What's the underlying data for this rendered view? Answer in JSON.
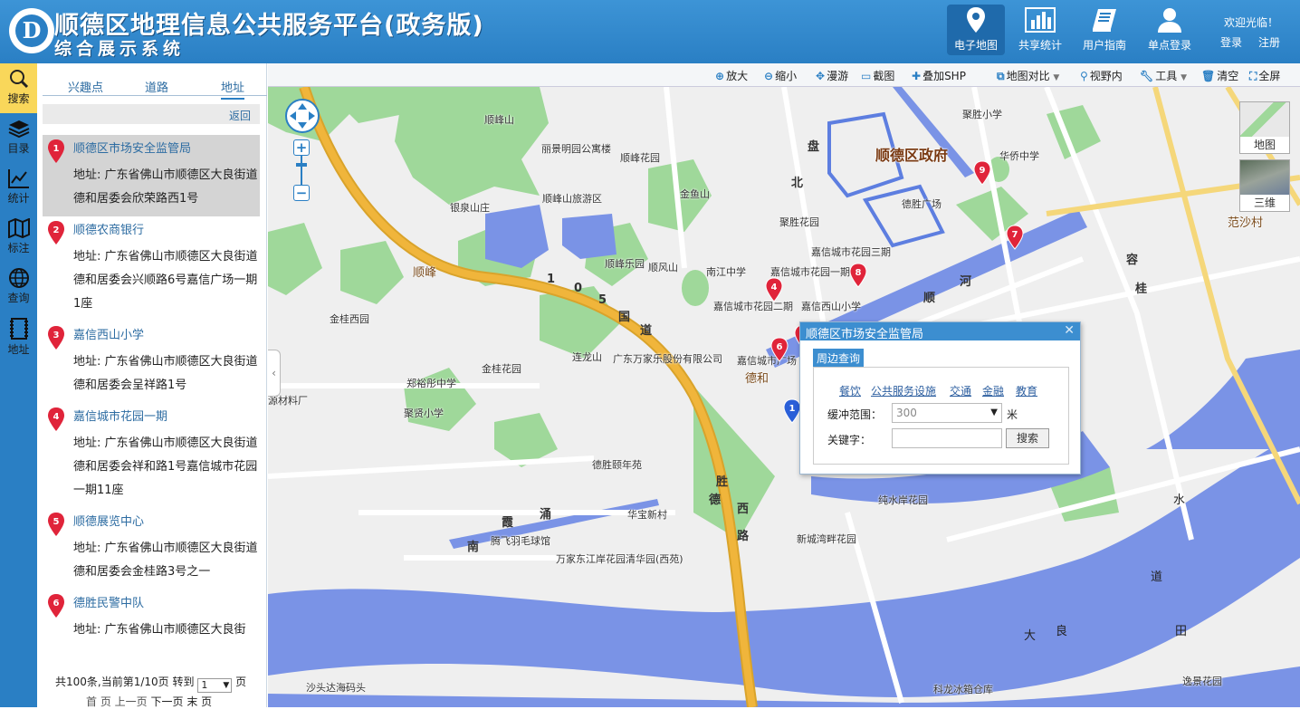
{
  "header": {
    "title": "顺德区地理信息公共服务平台(政务版)",
    "subtitle": "综合展示系统",
    "logo_letter": "D",
    "nav": [
      {
        "label": "电子地图",
        "icon": "map-pin-icon"
      },
      {
        "label": "共享统计",
        "icon": "bar-chart-icon"
      },
      {
        "label": "用户指南",
        "icon": "book-icon"
      },
      {
        "label": "单点登录",
        "icon": "user-icon"
      }
    ],
    "welcome": "欢迎光临！",
    "login": "登录",
    "register": "注册"
  },
  "iconbar": [
    {
      "label": "搜索",
      "icon": "search-icon",
      "active": true
    },
    {
      "label": "目录",
      "icon": "layers-icon"
    },
    {
      "label": "统计",
      "icon": "line-chart-icon"
    },
    {
      "label": "标注",
      "icon": "map-mark-icon"
    },
    {
      "label": "查询",
      "icon": "globe-icon"
    },
    {
      "label": "地址",
      "icon": "film-icon"
    }
  ],
  "panel": {
    "tabs": [
      "兴趣点",
      "道路",
      "地址"
    ],
    "back": "返回",
    "results": [
      {
        "no": "1",
        "name": "顺德区市场安全监管局",
        "address": "地址: 广东省佛山市顺德区大良街道德和居委会欣荣路西1号"
      },
      {
        "no": "2",
        "name": "顺德农商银行",
        "address": "地址: 广东省佛山市顺德区大良街道德和居委会兴顺路6号嘉信广场一期1座"
      },
      {
        "no": "3",
        "name": "嘉信西山小学",
        "address": "地址: 广东省佛山市顺德区大良街道德和居委会呈祥路1号"
      },
      {
        "no": "4",
        "name": "嘉信城市花园一期",
        "address": "地址: 广东省佛山市顺德区大良街道德和居委会祥和路1号嘉信城市花园一期11座"
      },
      {
        "no": "5",
        "name": "顺德展览中心",
        "address": "地址: 广东省佛山市顺德区大良街道德和居委会金桂路3号之一"
      },
      {
        "no": "6",
        "name": "德胜民警中队",
        "address": "地址: 广东省佛山市顺德区大良街"
      }
    ],
    "pager": {
      "summary": "共100条,当前第1/10页 转到",
      "page_value": "1",
      "page_unit": "页",
      "links": [
        "首 页",
        "上一页",
        "下一页",
        "末 页"
      ]
    }
  },
  "toolbar": [
    {
      "label": "放大",
      "icon": "zoom-in-icon"
    },
    {
      "label": "缩小",
      "icon": "zoom-out-icon"
    },
    {
      "label": "漫游",
      "icon": "pan-icon"
    },
    {
      "label": "截图",
      "icon": "screenshot-icon"
    },
    {
      "label": "叠加SHP",
      "icon": "plus-icon"
    },
    {
      "label": "地图对比",
      "icon": "compare-icon"
    },
    {
      "label": "视野内",
      "icon": "search-icon"
    },
    {
      "label": "工具",
      "icon": "wrench-icon"
    },
    {
      "label": "清空",
      "icon": "trash-icon"
    },
    {
      "label": "全屏",
      "icon": "fullscreen-icon"
    }
  ],
  "map": {
    "basemaps": [
      "地图",
      "三维"
    ],
    "labels": [
      "顺峰山",
      "丽景明园公寓楼",
      "顺峰花园",
      "银泉山庄",
      "顺峰山旅游区",
      "金鱼山",
      "顺峰乐园",
      "顺风山",
      "顺峰",
      "金桂西园",
      "金桂花园",
      "连龙山",
      "郑裕彤中学",
      "聚贤小学",
      "德胜颐年苑",
      "华宝新村",
      "腾飞羽毛球馆",
      "万家东江岸花园清华园(西苑)",
      "广东万家乐股份有限公司",
      "德和",
      "聚胜小学",
      "华侨中学",
      "德胜广场",
      "聚胜花园",
      "嘉信城市花园三期",
      "嘉信城市花园一期",
      "南江中学",
      "嘉信城市花园二期",
      "嘉信西山小学",
      "嘉信城市广场",
      "纯水岸花园",
      "新城湾畔花园",
      "范沙村",
      "沙头达海码头",
      "科龙冰箱仓库",
      "逸景花园",
      "源材料厂",
      "顺德区政府"
    ],
    "roads": [
      "1",
      "0",
      "5",
      "国",
      "道",
      "北",
      "盘",
      "河",
      "顺",
      "南",
      "霞",
      "涌",
      "德",
      "胜",
      "西",
      "路",
      "容",
      "桂",
      "水",
      "道",
      "大",
      "良",
      "田"
    ]
  },
  "popup": {
    "title": "顺德区市场安全监管局",
    "tab": "周边查询",
    "categories": [
      "餐饮",
      "公共服务设施",
      "交通",
      "金融",
      "教育"
    ],
    "buffer_label": "缓冲范围：",
    "buffer_value": "300",
    "buffer_unit": "米",
    "keyword_label": "关键字：",
    "keyword_value": "",
    "search_label": "搜索"
  },
  "colors": {
    "header": "#2a7fc4",
    "active_tab": "#f9d75a",
    "river": "#7a93e6",
    "green": "#9fd89a",
    "highway": "#f0b53b",
    "pin": "#e0243a",
    "pin_selected": "#2a5fd8"
  }
}
